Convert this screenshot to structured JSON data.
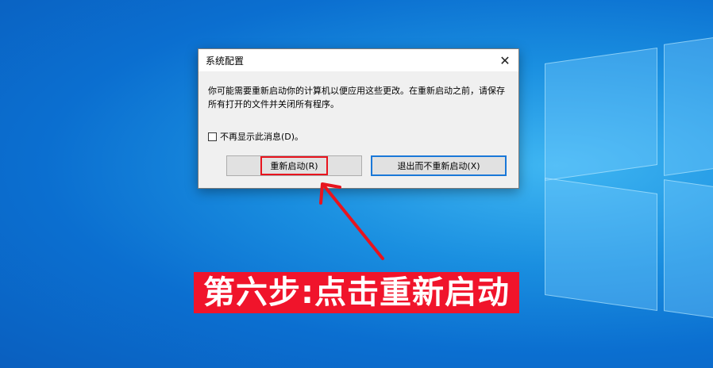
{
  "dialog": {
    "title": "系统配置",
    "close_glyph": "✕",
    "message": "你可能需要重新启动你的计算机以便应用这些更改。在重新启动之前，请保存所有打开的文件并关闭所有程序。",
    "checkbox_label": "不再显示此消息(D)。",
    "checkbox_checked": false,
    "restart_label": "重新启动(R)",
    "exit_label": "退出而不重新启动(X)"
  },
  "annotation": {
    "caption": "第六步:点击重新启动",
    "highlight_color": "#e8141e",
    "caption_bg": "#f0142b"
  },
  "icons": {
    "close": "close-icon",
    "arrow": "red-arrow-icon"
  }
}
